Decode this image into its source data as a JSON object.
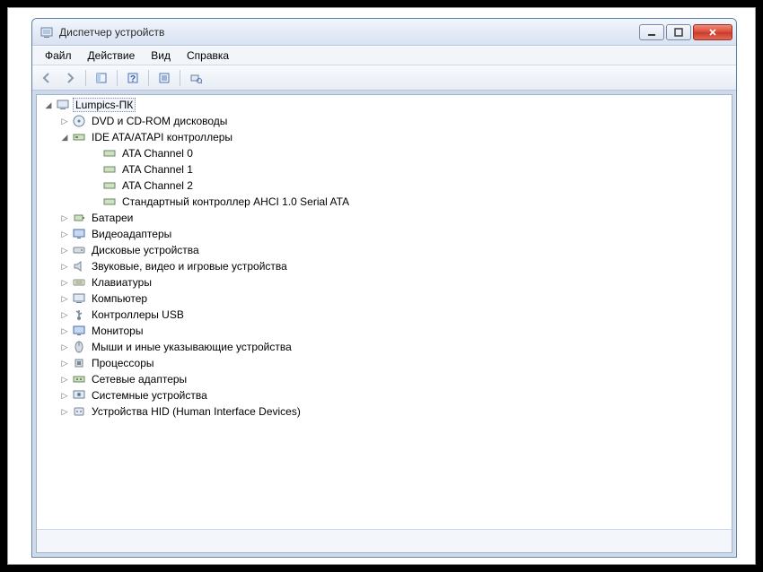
{
  "window": {
    "title": "Диспетчер устройств"
  },
  "menu": {
    "file": "Файл",
    "action": "Действие",
    "view": "Вид",
    "help": "Справка"
  },
  "tree": {
    "root": "Lumpics-ПК",
    "dvd": "DVD и CD-ROM дисководы",
    "ide": "IDE ATA/ATAPI контроллеры",
    "ide_children": {
      "ch0": "ATA Channel 0",
      "ch1": "ATA Channel 1",
      "ch2": "ATA Channel 2",
      "ahci": "Стандартный контроллер AHCI 1.0 Serial ATA"
    },
    "battery": "Батареи",
    "video": "Видеоадаптеры",
    "disk": "Дисковые устройства",
    "sound": "Звуковые, видео и игровые устройства",
    "keyboard": "Клавиатуры",
    "computer": "Компьютер",
    "usb": "Контроллеры USB",
    "monitor": "Мониторы",
    "mouse": "Мыши и иные указывающие устройства",
    "cpu": "Процессоры",
    "network": "Сетевые адаптеры",
    "system": "Системные устройства",
    "hid": "Устройства HID (Human Interface Devices)"
  }
}
